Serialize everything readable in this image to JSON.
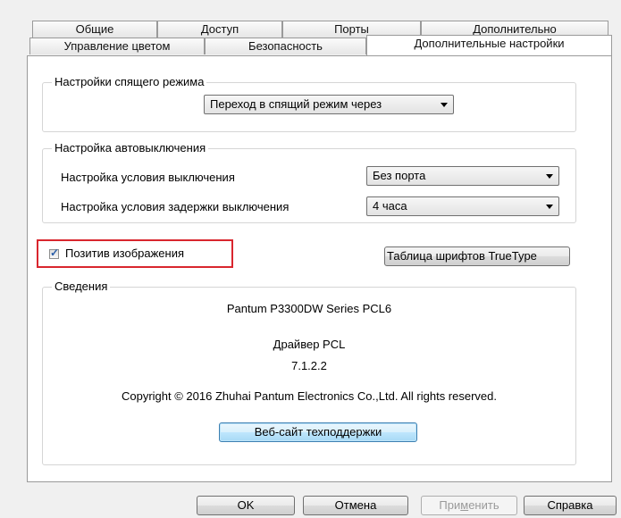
{
  "tabs_row1": [
    {
      "label": "Общие"
    },
    {
      "label": "Доступ"
    },
    {
      "label": "Порты"
    },
    {
      "label": "Дополнительно"
    }
  ],
  "tabs_row2": [
    {
      "label": "Управление цветом"
    },
    {
      "label": "Безопасность"
    },
    {
      "label": "Дополнительные настройки",
      "active": true
    }
  ],
  "sleep_group": {
    "title": "Настройки спящего режима",
    "combo_value": "Переход в спящий режим через"
  },
  "autooff_group": {
    "title": "Настройка автовыключения",
    "condition_label": "Настройка условия выключения",
    "condition_value": "Без порта",
    "delay_label": "Настройка условия задержки выключения",
    "delay_value": "4 часа"
  },
  "positive_image": {
    "label": "Позитив изображения",
    "checked": true
  },
  "truetype_button": "Таблица шрифтов TrueType",
  "info_group": {
    "title": "Сведения",
    "product": "Pantum P3300DW Series PCL6",
    "driver_label": "Драйвер PCL",
    "version": "7.1.2.2",
    "copyright": "Copyright © 2016 Zhuhai Pantum Electronics Co.,Ltd. All rights reserved.",
    "support_button": "Веб-сайт техподдержки"
  },
  "footer": {
    "ok": "OK",
    "cancel": "Отмена",
    "apply_prefix": "При",
    "apply_underlined": "м",
    "apply_suffix": "енить",
    "help": "Справка"
  },
  "colors": {
    "highlight_border": "#d9262e",
    "focus_button": "#a7d9f5"
  }
}
